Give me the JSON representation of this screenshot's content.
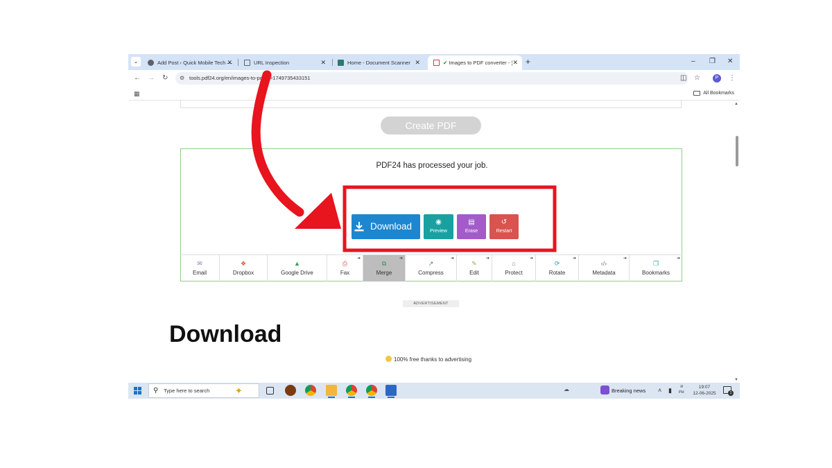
{
  "browser": {
    "tabs": [
      {
        "title": "Add Post ‹ Quick Mobile Tech —",
        "icon": "wordpress-icon",
        "active": false
      },
      {
        "title": "URL Inspection",
        "icon": "search-console-icon",
        "active": false
      },
      {
        "title": "Home - Document Scanner",
        "icon": "document-scanner-icon",
        "active": false
      },
      {
        "title": "Images to PDF converter - ¦",
        "icon": "pdf24-icon",
        "active": true
      }
    ],
    "tab_close": "✕",
    "new_tab": "+",
    "window": {
      "minimize": "–",
      "restore": "❐",
      "close": "✕"
    },
    "nav": {
      "back": "←",
      "forward": "→",
      "reload": "↻"
    },
    "url": "tools.pdf24.org/en/images-to-pdf#s=1749735433151",
    "profile_initial": "P",
    "bookmarks": {
      "all": "All Bookmarks"
    }
  },
  "page": {
    "create_button": "Create PDF",
    "result_message": "PDF24 has processed your job.",
    "actions": {
      "download": "Download",
      "preview": "Preview",
      "erase": "Erase",
      "restart": "Restart"
    },
    "tools": [
      {
        "label": "Email",
        "icon": "email-icon",
        "color": "#8e7fa8",
        "glyph": "✉",
        "arrow": false
      },
      {
        "label": "Dropbox",
        "icon": "dropbox-icon",
        "color": "#e05a2b",
        "glyph": "❖",
        "arrow": false
      },
      {
        "label": "Google Drive",
        "icon": "google-drive-icon",
        "color": "#2e9e4f",
        "glyph": "▲",
        "arrow": false
      },
      {
        "label": "Fax",
        "icon": "fax-icon",
        "color": "#d9534f",
        "glyph": "⎙",
        "arrow": true
      },
      {
        "label": "Merge",
        "icon": "merge-icon",
        "color": "#3a8a5a",
        "glyph": "⧉",
        "arrow": true
      },
      {
        "label": "Compress",
        "icon": "compress-icon",
        "color": "#3a8a5a",
        "glyph": "↗",
        "arrow": true
      },
      {
        "label": "Edit",
        "icon": "edit-icon",
        "color": "#8bb34a",
        "glyph": "✎",
        "arrow": true
      },
      {
        "label": "Protect",
        "icon": "lock-icon",
        "color": "#777777",
        "glyph": "⌂",
        "arrow": true
      },
      {
        "label": "Rotate",
        "icon": "rotate-icon",
        "color": "#2aa0a0",
        "glyph": "⟳",
        "arrow": true
      },
      {
        "label": "Metadata",
        "icon": "code-icon",
        "color": "#777777",
        "glyph": "‹/›",
        "arrow": true
      },
      {
        "label": "Bookmarks",
        "icon": "bookmarks-icon",
        "color": "#2aa0a0",
        "glyph": "❐",
        "arrow": true
      }
    ],
    "ad_label": "ADVERTISEMENT",
    "free_note": "100% free thanks to advertising"
  },
  "annotation": {
    "heading": "Download",
    "highlight_color": "#e8141e",
    "arrow_color": "#e8141e"
  },
  "taskbar": {
    "search_placeholder": "Type here to search",
    "news": "Breaking news",
    "ime_top": "अ",
    "ime_bottom": "PH",
    "time": "19:07",
    "date": "12-06-2025",
    "notifications": "1"
  }
}
